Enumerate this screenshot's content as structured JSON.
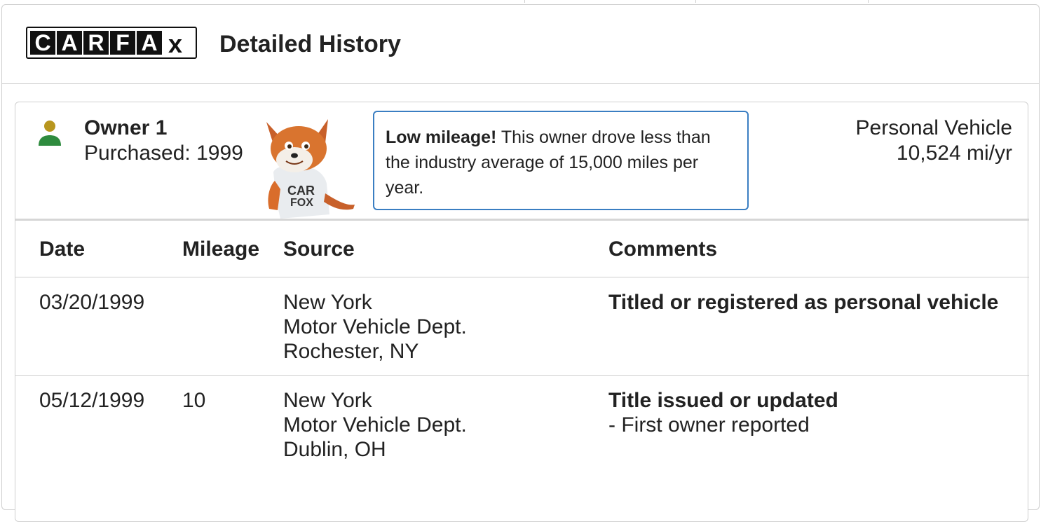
{
  "header": {
    "logo_letters": [
      "C",
      "A",
      "R",
      "F",
      "A"
    ],
    "logo_tail": "x",
    "title": "Detailed History"
  },
  "owner": {
    "name": "Owner 1",
    "purchased": "Purchased: 1999",
    "callout_bold": "Low mileage!",
    "callout_text": " This owner drove less than the industry average of 15,000 miles per year.",
    "vehicle_type": "Personal Vehicle",
    "miles_per_year": "10,524 mi/yr",
    "mascot_shirt": [
      "CAR",
      "FOX"
    ]
  },
  "table": {
    "headers": {
      "date": "Date",
      "mileage": "Mileage",
      "source": "Source",
      "comments": "Comments"
    },
    "rows": [
      {
        "date": "03/20/1999",
        "mileage": "",
        "source": [
          "New York",
          "Motor Vehicle Dept.",
          "Rochester, NY"
        ],
        "comment_title": "Titled or registered as personal vehicle",
        "comment_detail": ""
      },
      {
        "date": "05/12/1999",
        "mileage": "10",
        "source": [
          "New York",
          "Motor Vehicle Dept.",
          "Dublin, OH"
        ],
        "comment_title": "Title issued or updated",
        "comment_detail": "- First owner reported"
      }
    ]
  },
  "colors": {
    "callout_border": "#3a7ec2",
    "person_head": "#b8961e",
    "person_body": "#2e8b3e"
  },
  "icons": {
    "owner": "person-icon",
    "mascot": "fox-mascot-icon"
  }
}
